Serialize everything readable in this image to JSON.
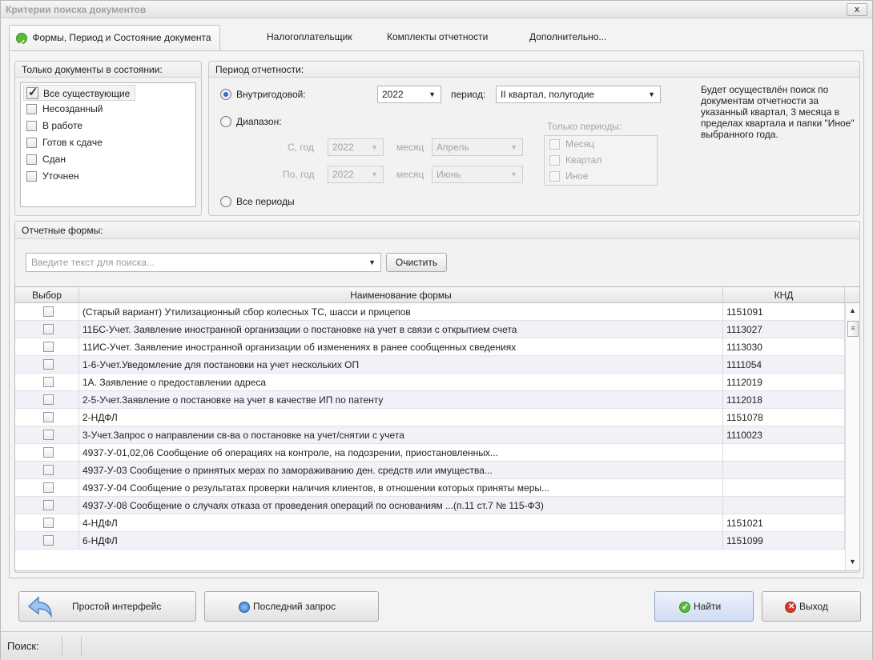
{
  "window": {
    "title": "Критерии поиска документов",
    "close_label": "x"
  },
  "tabs": [
    {
      "label": "Формы, Период и Состояние документа",
      "active": true
    },
    {
      "label": "Налогоплательщик"
    },
    {
      "label": "Комплекты отчетности"
    },
    {
      "label": "Дополнительно..."
    }
  ],
  "states": {
    "title": "Только документы в состоянии:",
    "items": [
      {
        "label": "Все существующие",
        "checked": true
      },
      {
        "label": "Несозданный"
      },
      {
        "label": "В работе"
      },
      {
        "label": "Готов к сдаче"
      },
      {
        "label": "Сдан"
      },
      {
        "label": "Уточнен"
      }
    ]
  },
  "period": {
    "title": "Период отчетности:",
    "intra_label": "Внутригодовой:",
    "year": "2022",
    "period_label": "период:",
    "period_value": "II квартал, полугодие",
    "range_label": "Диапазон:",
    "from_year_label": "С, год",
    "from_year": "2022",
    "month_label": "месяц",
    "from_month": "Апрель",
    "to_year_label": "По, год",
    "to_year": "2022",
    "to_month": "Июнь",
    "only_periods_label": "Только периоды:",
    "only_periods": [
      "Месяц",
      "Квартал",
      "Иное"
    ],
    "all_label": "Все периоды",
    "note": "Будет осуществлён поиск по документам отчетности за указанный квартал, 3 месяца в пределах квартала и папки \"Иное\" выбранного года."
  },
  "forms": {
    "title": "Отчетные формы:",
    "search_placeholder": "Введите текст для поиска...",
    "clear_label": "Очистить",
    "columns": [
      "Выбор",
      "Наименование формы",
      "КНД"
    ],
    "rows": [
      {
        "name": "(Старый вариант) Утилизационный сбор колесных ТС, шасси и прицепов",
        "knd": "1151091"
      },
      {
        "name": "11БС-Учет. Заявление иностранной организации о постановке на учет в связи с открытием счета",
        "knd": "1113027"
      },
      {
        "name": "11ИС-Учет. Заявление иностранной организации об изменениях в ранее сообщенных сведениях",
        "knd": "1113030"
      },
      {
        "name": "1-6-Учет.Уведомление для постановки на учет нескольких ОП",
        "knd": "1111054"
      },
      {
        "name": "1А. Заявление о предоставлении адреса",
        "knd": "1112019"
      },
      {
        "name": "2-5-Учет.Заявление о постановке на учет в качестве ИП по патенту",
        "knd": "1112018"
      },
      {
        "name": "2-НДФЛ",
        "knd": "1151078"
      },
      {
        "name": "3-Учет.Запрос о направлении св-ва о постановке на учет/снятии с учета",
        "knd": "1110023"
      },
      {
        "name": "4937-У-01,02,06 Сообщение об операциях на контроле, на подозрении, приостановленных...",
        "knd": ""
      },
      {
        "name": "4937-У-03 Сообщение о принятых мерах по замораживанию ден. средств или имущества...",
        "knd": ""
      },
      {
        "name": "4937-У-04 Сообщение о результатах проверки наличия клиентов, в отношении которых приняты меры...",
        "knd": ""
      },
      {
        "name": "4937-У-08 Сообщение о случаях отказа от проведения операций по основаниям ...(п.11 ст.7 № 115-ФЗ)",
        "knd": ""
      },
      {
        "name": "4-НДФЛ",
        "knd": "1151021"
      },
      {
        "name": "6-НДФЛ",
        "knd": "1151099"
      }
    ]
  },
  "buttons": {
    "simple": "Простой интерфейс",
    "last": "Последний запрос",
    "find": "Найти",
    "exit": "Выход"
  },
  "status": {
    "search_label": "Поиск:"
  },
  "colors": {
    "accent_green": "#5cb83a",
    "exit_red": "#d9382c",
    "radio_blue": "#2d6fd0"
  }
}
